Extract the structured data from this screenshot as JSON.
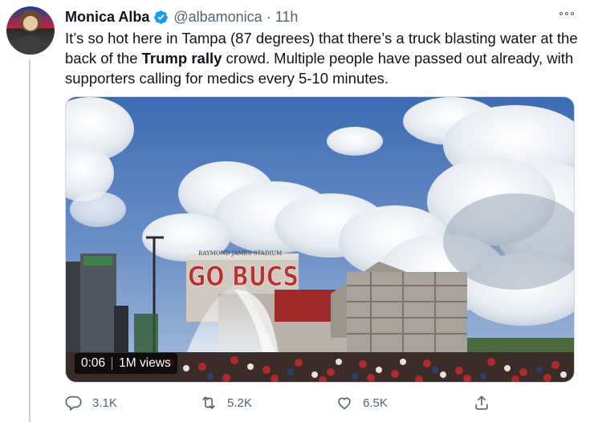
{
  "tweet": {
    "author_name": "Monica Alba",
    "author_handle": "@albamonica",
    "separator": "·",
    "time": "11h",
    "text": {
      "part1": "It’s so hot here in Tampa (87 degrees) that there’s a truck blasting water at the back of the ",
      "bold": "Trump rally",
      "part2": " crowd. Multiple people have passed out already, with supporters calling for medics every 5-10 minutes."
    },
    "media": {
      "duration": "0:06",
      "views": "1M views",
      "stadium_sign": "RAYMOND JAMES STADIUM",
      "banner_text": "GO BUCS"
    },
    "actions": {
      "replies": "3.1K",
      "retweets": "5.2K",
      "likes": "6.5K"
    }
  },
  "icons": {
    "verified": "verified-badge-icon",
    "more": "more-options-icon",
    "reply": "reply-icon",
    "retweet": "retweet-icon",
    "like": "heart-icon",
    "share": "share-icon"
  },
  "colors": {
    "verified_blue": "#1d9bf0",
    "secondary_text": "#536471",
    "primary_text": "#0f1419"
  }
}
